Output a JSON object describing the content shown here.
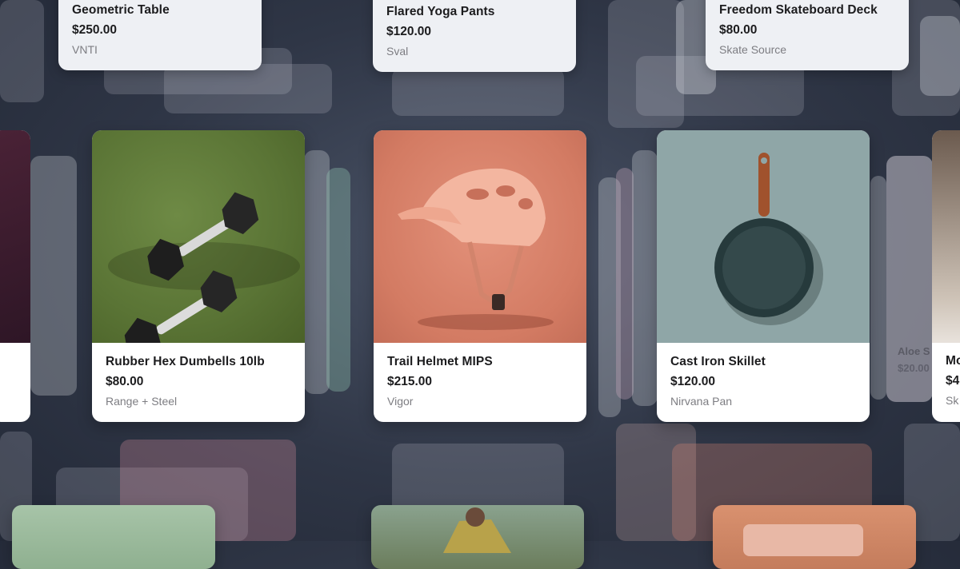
{
  "top_row": [
    {
      "name": "Geometric Table",
      "price": "$250.00",
      "brand": "VNTI"
    },
    {
      "name": "Flared Yoga Pants",
      "price": "$120.00",
      "brand": "Sval"
    },
    {
      "name": "Freedom Skateboard Deck",
      "price": "$80.00",
      "brand": "Skate Source"
    }
  ],
  "products": [
    {
      "name": "Rubber Hex Dumbells 10lb",
      "price": "$80.00",
      "brand": "Range + Steel",
      "icon": "dumbbells-image"
    },
    {
      "name": "Trail Helmet MIPS",
      "price": "$215.00",
      "brand": "Vigor",
      "icon": "helmet-image"
    },
    {
      "name": "Cast Iron Skillet",
      "price": "$120.00",
      "brand": "Nirvana Pan",
      "icon": "skillet-image"
    }
  ],
  "partial_right": {
    "name": "Mo",
    "price": "$4",
    "brand": "Sk"
  },
  "ghost_right": {
    "name": "Aloe S",
    "price": "$20.00"
  },
  "colors": {
    "grass": "#5e7a3a",
    "helmet_bg": "#d9826a",
    "skillet_bg": "#8fa6a7"
  }
}
